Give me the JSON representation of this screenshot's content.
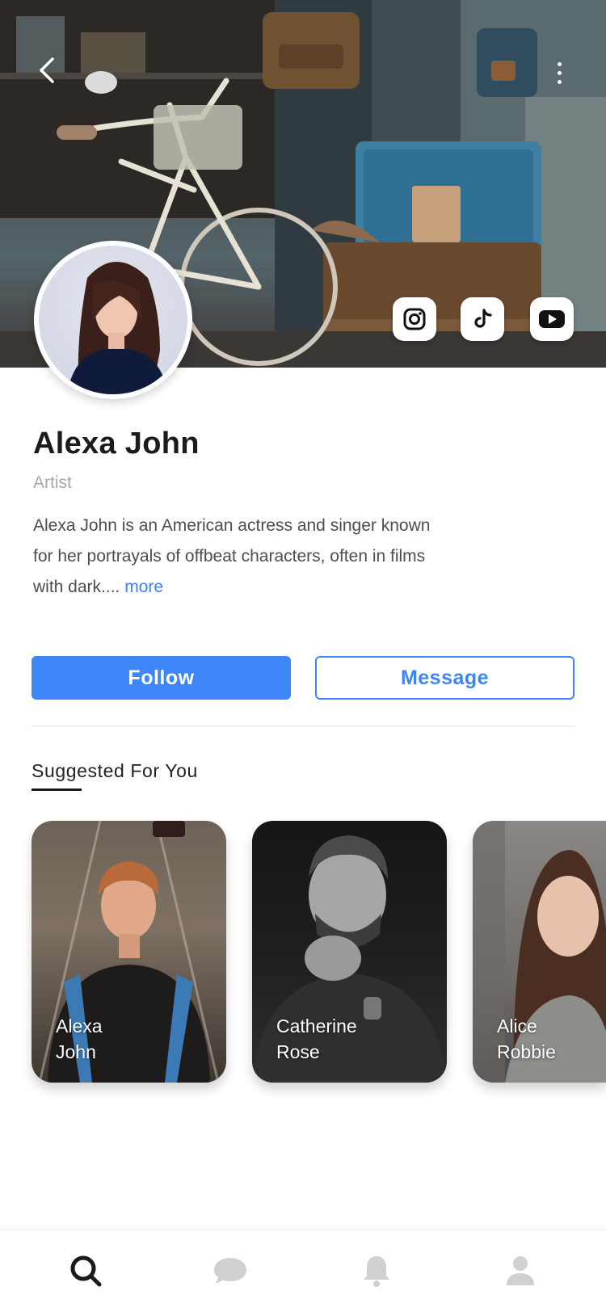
{
  "profile": {
    "name": "Alexa John",
    "role": "Artist",
    "bio": "Alexa John  is an American actress and singer known for her portrayals of offbeat characters, often in films with dark.... ",
    "more_label": "more"
  },
  "social_links": [
    {
      "icon": "instagram-icon"
    },
    {
      "icon": "tiktok-icon"
    },
    {
      "icon": "youtube-icon"
    }
  ],
  "actions": {
    "follow_label": "Follow",
    "message_label": "Message"
  },
  "suggested": {
    "title": "Suggested For You",
    "cards": [
      {
        "first": "Alexa",
        "last": "John"
      },
      {
        "first": "Catherine",
        "last": "Rose"
      },
      {
        "first": "Alice",
        "last": "Robbie"
      }
    ]
  },
  "nav": {
    "items": [
      {
        "icon": "search-icon",
        "active": true
      },
      {
        "icon": "chat-icon",
        "active": false
      },
      {
        "icon": "bell-icon",
        "active": false
      },
      {
        "icon": "user-icon",
        "active": false
      }
    ]
  },
  "colors": {
    "accent": "#3d86f7",
    "nav_active": "#1a1a1a",
    "nav_inactive": "#cfcfcf"
  }
}
